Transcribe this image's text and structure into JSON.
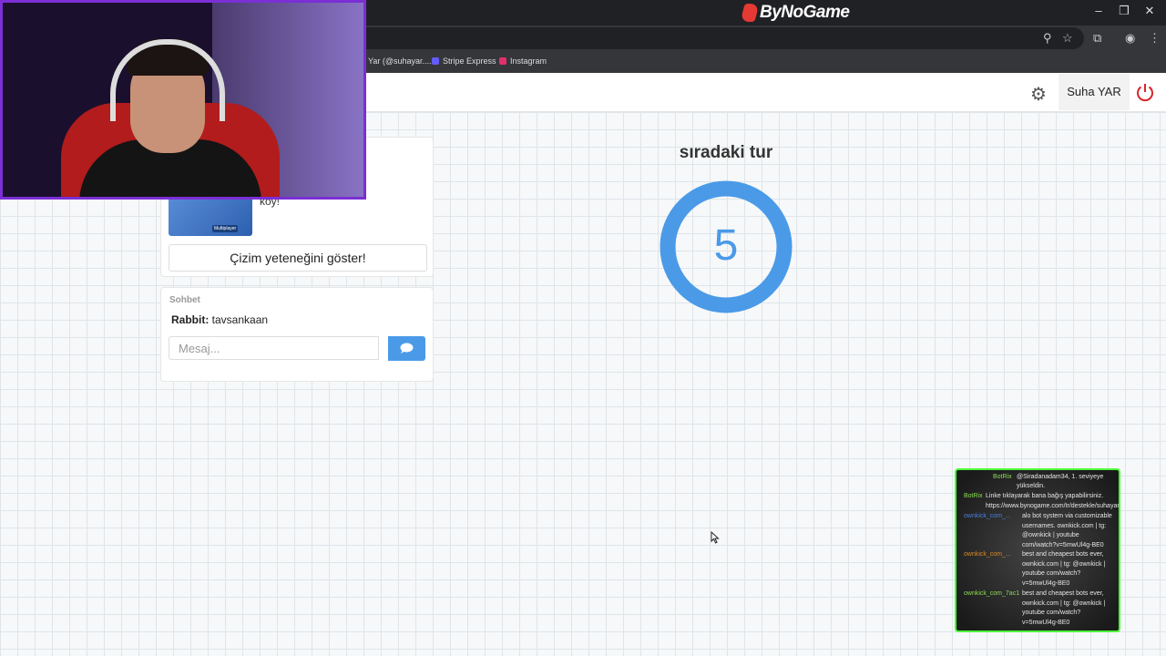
{
  "browser": {
    "brand": "ByNoGame",
    "bookmarks": [
      {
        "label": "Yar (@suhayar....",
        "color": "#888888"
      },
      {
        "label": "Stripe Express",
        "color": "#635bff"
      },
      {
        "label": "Instagram",
        "color": "#e1306c"
      }
    ]
  },
  "header": {
    "username": "Suha YAR"
  },
  "game": {
    "description": "çiz, en\narkını ortaya\nkoy!",
    "thumb_badge": "Multiplayer",
    "show_button": "Çizim yeteneğini göster!"
  },
  "chat": {
    "title": "Sohbet",
    "messages": [
      {
        "user": "Rabbit:",
        "text": "tavsankaan"
      }
    ],
    "input_placeholder": "Mesaj..."
  },
  "timer": {
    "label": "sıradaki tur",
    "value": "5",
    "color": "#4a9ae8"
  },
  "stream_chat": {
    "border_color": "#4cff3a",
    "messages": [
      {
        "user": "BotRix",
        "user_color": "#8bdc55",
        "lines": [
          "@Siradanadam34, 1. seviyeye",
          "yükseldin."
        ]
      },
      {
        "user": "BotRix",
        "user_color": "#8bdc55",
        "lines": [
          "Linke tıklayarak bana bağış yapabilirsiniz.",
          "https://www.bynogame.com/tr/destekle/suhayar"
        ]
      },
      {
        "user": "ownkick_com_...",
        "user_color": "#4a7fd8",
        "lines": [
          "alo bot system via customizable",
          "usernames. ownkick.com | tg:",
          "@ownkick | youtube",
          "com/watch?v=5mwUl4g-BE0"
        ]
      },
      {
        "user": "ownkick_com_...",
        "user_color": "#d88a2a",
        "lines": [
          "best and cheapest bots ever,",
          "ownkick.com | tg: @ownkick |",
          "youtube com/watch?",
          "v=5mwUl4g-BE0"
        ]
      },
      {
        "user": "ownkick_com_7ac1",
        "user_color": "#8bdc55",
        "lines": [
          "best and cheapest bots ever,",
          "ownkick.com | tg: @ownkick |",
          "youtube com/watch?",
          "v=5mwUl4g-BE0"
        ]
      }
    ]
  }
}
